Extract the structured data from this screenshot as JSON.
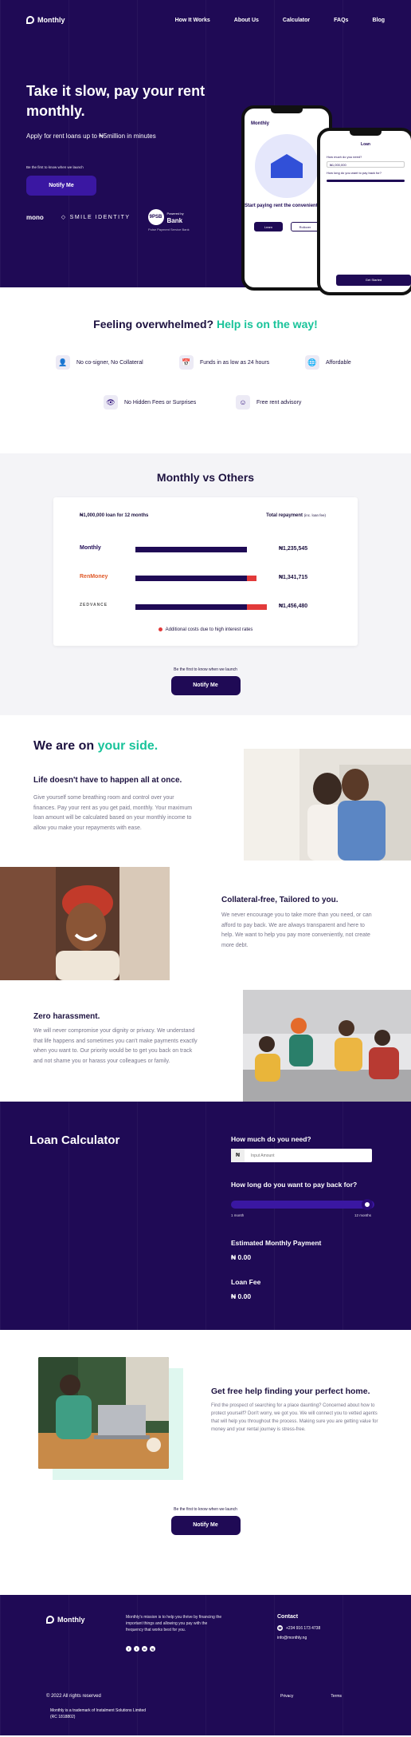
{
  "brand": {
    "name": "Monthly"
  },
  "nav": {
    "links": [
      "How It Works",
      "About Us",
      "Calculator",
      "FAQs",
      "Blog"
    ]
  },
  "hero": {
    "headline": "Take it slow, pay your rent monthly.",
    "subtitle": "Apply for rent loans up to ₦5million in minutes",
    "first_text": "Be the first to know when we launch",
    "notify_label": "Notify Me",
    "partners": {
      "mono": "mono",
      "smile": "SMILE IDENTITY",
      "bank_num": "9PSB",
      "bank_line1": "Powered by",
      "bank_line2": "Bank",
      "bank_reg": "Pulse Payment Service Bank"
    },
    "phone1": {
      "logo": "Monthly",
      "caption": "Start paying rent the convenient way.",
      "btn1": "Learn",
      "btn2": "Rollover"
    },
    "phone2": {
      "title": "Loan",
      "lbl1": "How much do you need?",
      "val1": "₦1,000,000",
      "lbl2": "How long do you want to pay back for?",
      "submit": "Get Started"
    }
  },
  "features": {
    "heading_main": "Feeling overwhelmed? ",
    "heading_accent": "Help is on the way!",
    "items": [
      {
        "icon": "user-icon",
        "glyph": "👤",
        "label": "No co-signer, No Collateral"
      },
      {
        "icon": "calendar-icon",
        "glyph": "📅",
        "label": "Funds in as low as 24 hours"
      },
      {
        "icon": "globe-icon",
        "glyph": "🌐",
        "label": "Affordable"
      },
      {
        "icon": "eye-off-icon",
        "glyph": "👁",
        "label": "No Hidden Fees or Surprises"
      },
      {
        "icon": "smile-icon",
        "glyph": "☺",
        "label": "Free rent advisory"
      }
    ]
  },
  "vs": {
    "heading": "Monthly vs Others",
    "loan_label": "₦1,000,000 loan for 12 months",
    "repay_label": "Total repayment",
    "repay_note": "(inc. loan fee)",
    "rows": [
      {
        "brand": "Monthly",
        "amount": "₦1,235,545",
        "total": 1235545
      },
      {
        "brand": "RenMoney",
        "amount": "₦1,341,715",
        "total": 1341715
      },
      {
        "brand": "ZEDVANCE",
        "amount": "₦1,456,480",
        "total": 1456480
      }
    ],
    "legend": "Additional costs due to high interest rates",
    "first_text": "Be the first to know when we launch",
    "notify_label": "Notify Me"
  },
  "side": {
    "heading_main": "We are on ",
    "heading_accent": "your side.",
    "block1_title": "Life doesn't have to happen all at once.",
    "block1_text": "Give yourself some breathing room and control over your finances. Pay your rent as you get paid, monthly. Your maximum loan amount will be calculated based on your monthly income to allow you make your repayments with ease.",
    "block2_title": "Collateral-free, Tailored to you.",
    "block2_text": "We never encourage you to take more than you need, or can afford to pay back. We are always transparent and here to help. We want to help you pay more conveniently, not create more debt.",
    "block3_title": "Zero harassment.",
    "block3_text": "We will never compromise your dignity or privacy. We understand that life happens and sometimes you can't make payments exactly when you want to. Our priority would be to get you back on track and not shame you or harass your colleagues or family."
  },
  "calc": {
    "title": "Loan Calculator",
    "q1": "How much do you need?",
    "currency": "₦",
    "placeholder": "Input Amount",
    "q2": "How long do you want to pay back for?",
    "min_label": "1 month",
    "max_label": "12 months",
    "slider_value": 1.0,
    "est_label": "Estimated Monthly Payment",
    "est_value": "₦ 0.00",
    "fee_label": "Loan Fee",
    "fee_value": "₦ 0.00"
  },
  "help": {
    "title": "Get free help finding your perfect home.",
    "text": "Find the prospect of searching for a place daunting? Concerned about how to protect yourself? Don't worry, we got you. We will connect you to vetted agents that will help you throughout the process. Making sure you are getting value for money and your rental journey is stress-free.",
    "first_text": "Be the first to know when we launch",
    "notify_label": "Notify Me"
  },
  "footer": {
    "mission": "Monthly's mission is to help you thrive by financing the important things and allowing you pay with the frequency that works best for you.",
    "social": [
      "f",
      "t",
      "in",
      "ig"
    ],
    "contact_title": "Contact",
    "phone": "+234 916 173 4738",
    "email": "info@monthly.ng",
    "copyright": "© 2022 All rights reserved",
    "legal": "Monthly is a trademark of Instalment Solutions Limited (RC 1818802)",
    "privacy": "Privacy",
    "terms": "Terms"
  }
}
